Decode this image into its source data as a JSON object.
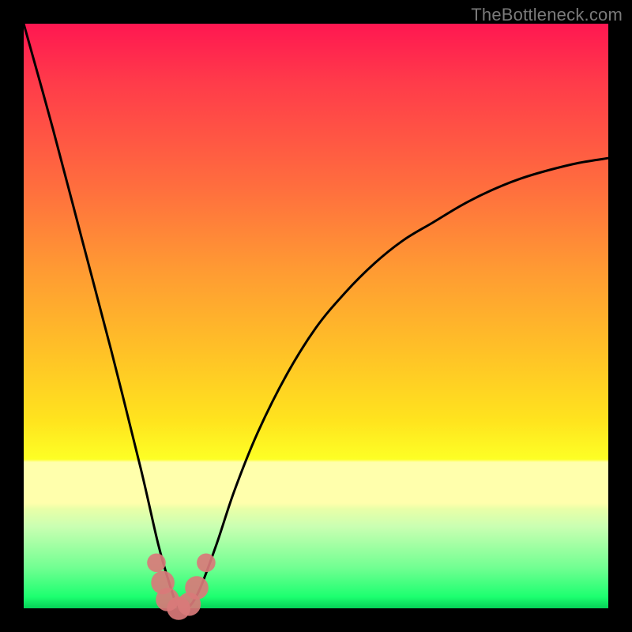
{
  "watermark": "TheBottleneck.com",
  "chart_data": {
    "type": "line",
    "title": "",
    "xlabel": "",
    "ylabel": "",
    "xlim": [
      0,
      100
    ],
    "ylim": [
      0,
      100
    ],
    "grid": false,
    "legend": false,
    "series": [
      {
        "name": "bottleneck-curve",
        "x": [
          0,
          5,
          10,
          15,
          20,
          23,
          25,
          26.5,
          28,
          30,
          33,
          36,
          40,
          45,
          50,
          55,
          60,
          65,
          70,
          75,
          80,
          85,
          90,
          95,
          100
        ],
        "y": [
          100,
          82,
          63,
          44,
          24,
          11,
          4,
          0,
          0,
          3,
          11,
          20,
          30,
          40,
          48,
          54,
          59,
          63,
          66,
          69,
          71.5,
          73.5,
          75,
          76.2,
          77
        ]
      }
    ],
    "markers": [
      {
        "x": 22.7,
        "y": 7.8,
        "r": 1.6
      },
      {
        "x": 23.8,
        "y": 4.4,
        "r": 2.0
      },
      {
        "x": 24.6,
        "y": 1.5,
        "r": 2.0
      },
      {
        "x": 26.5,
        "y": 0.0,
        "r": 2.0
      },
      {
        "x": 28.3,
        "y": 0.7,
        "r": 2.0
      },
      {
        "x": 29.6,
        "y": 3.5,
        "r": 2.0
      },
      {
        "x": 31.2,
        "y": 7.8,
        "r": 1.6
      }
    ],
    "notes": "A V-shaped bottleneck curve: steep descent on the left, minimum near x≈27, then a rising curve that flattens toward the right. No axis ticks or labels shown."
  },
  "colors": {
    "background": "#000000",
    "curve": "#000000",
    "marker": "#d97a7a"
  }
}
